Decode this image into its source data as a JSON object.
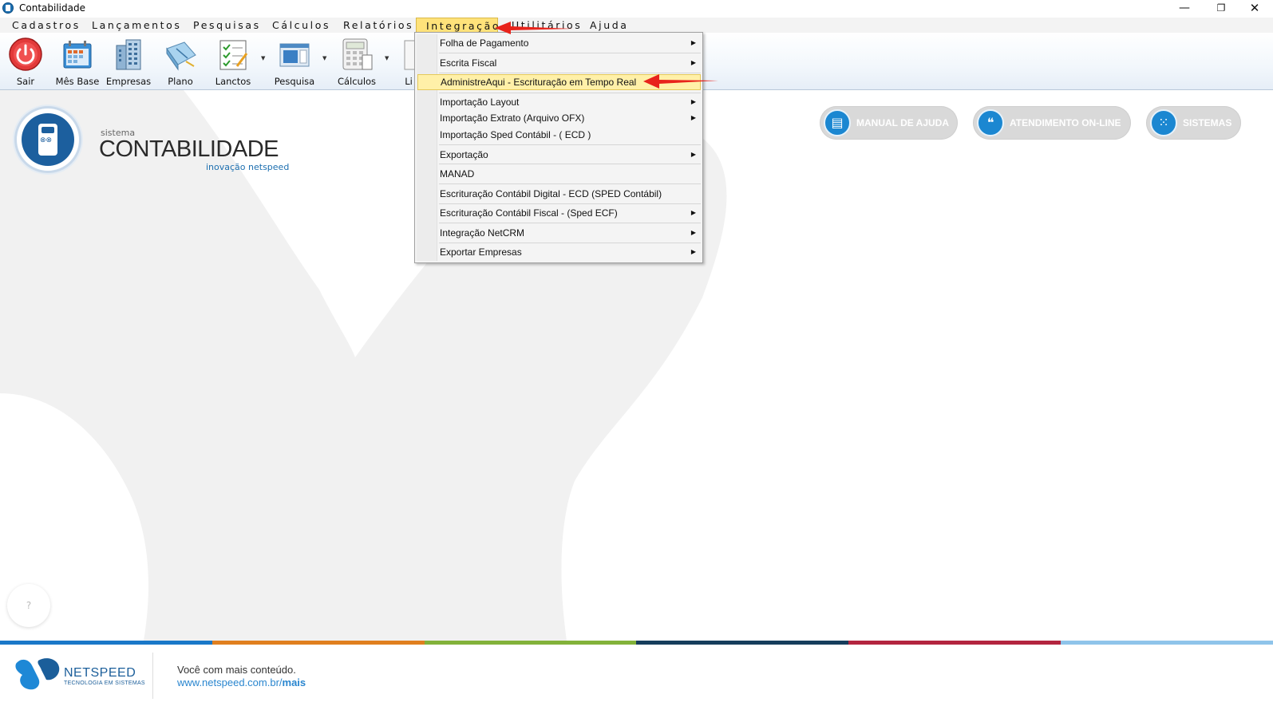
{
  "window": {
    "title": "Contabilidade",
    "min_glyph": "—",
    "max_glyph": "❐",
    "close_glyph": "✕"
  },
  "menubar": {
    "items": [
      {
        "label": "Cadastros"
      },
      {
        "label": "Lançamentos"
      },
      {
        "label": "Pesquisas"
      },
      {
        "label": "Cálculos"
      },
      {
        "label": "Relatórios"
      },
      {
        "label": "Integração",
        "active": true
      },
      {
        "label": "Utilitários"
      },
      {
        "label": "Ajuda"
      }
    ]
  },
  "toolbar": {
    "buttons": [
      {
        "label": "Sair",
        "icon": "power-icon"
      },
      {
        "label": "Mês Base",
        "icon": "calendar-icon"
      },
      {
        "label": "Empresas",
        "icon": "building-icon"
      },
      {
        "label": "Plano",
        "icon": "notebook-icon"
      },
      {
        "label": "Lanctos",
        "icon": "checklist-icon"
      },
      {
        "label": "Pesquisa",
        "icon": "window-icon"
      },
      {
        "label": "Cálculos",
        "icon": "calculator-icon"
      },
      {
        "label": "Li",
        "icon": "list-icon"
      }
    ]
  },
  "dropdown": {
    "items": [
      {
        "label": "Folha de Pagamento",
        "submenu": true
      },
      {
        "label": "Escrita Fiscal",
        "submenu": true
      },
      {
        "label": "AdministreAqui - Escrituração em Tempo Real",
        "submenu": false,
        "highlighted": true
      },
      {
        "label": "Importação Layout",
        "submenu": true
      },
      {
        "label": "Importação Extrato (Arquivo OFX)",
        "submenu": true
      },
      {
        "label": "Importação Sped Contábil - ( ECD )",
        "submenu": false
      },
      {
        "label": "Exportação",
        "submenu": true
      },
      {
        "label": "MANAD",
        "submenu": false
      },
      {
        "label": "Escrituração Contábil Digital - ECD (SPED Contábil)",
        "submenu": false
      },
      {
        "label": "Escrituração Contábil Fiscal - (Sped ECF)",
        "submenu": true
      },
      {
        "label": "Integração NetCRM",
        "submenu": true
      },
      {
        "label": "Exportar Empresas",
        "submenu": true
      }
    ],
    "arrow_glyph": "▶"
  },
  "brand": {
    "sistema": "sistema",
    "title": "CONTABILIDADE",
    "tagline": "inovação netspeed"
  },
  "actions": {
    "manual": "MANUAL DE AJUDA",
    "atendimento": "ATENDIMENTO ON-LINE",
    "sistemas": "SISTEMAS"
  },
  "help": {
    "glyph": "?"
  },
  "footer": {
    "company": "NETSPEED",
    "company_sub": "TECNOLOGIA EM SISTEMAS",
    "message": "Você com mais conteúdo.",
    "link_prefix": "www.netspeed.com.br/",
    "link_bold": "mais"
  },
  "colors": {
    "strip": [
      "#1a78c8",
      "#e07f1f",
      "#82b23a",
      "#163d5c",
      "#b3253f",
      "#8fc4ea"
    ],
    "accent_blue": "#1b87d1",
    "menu_highlight": "#ffe27a"
  }
}
